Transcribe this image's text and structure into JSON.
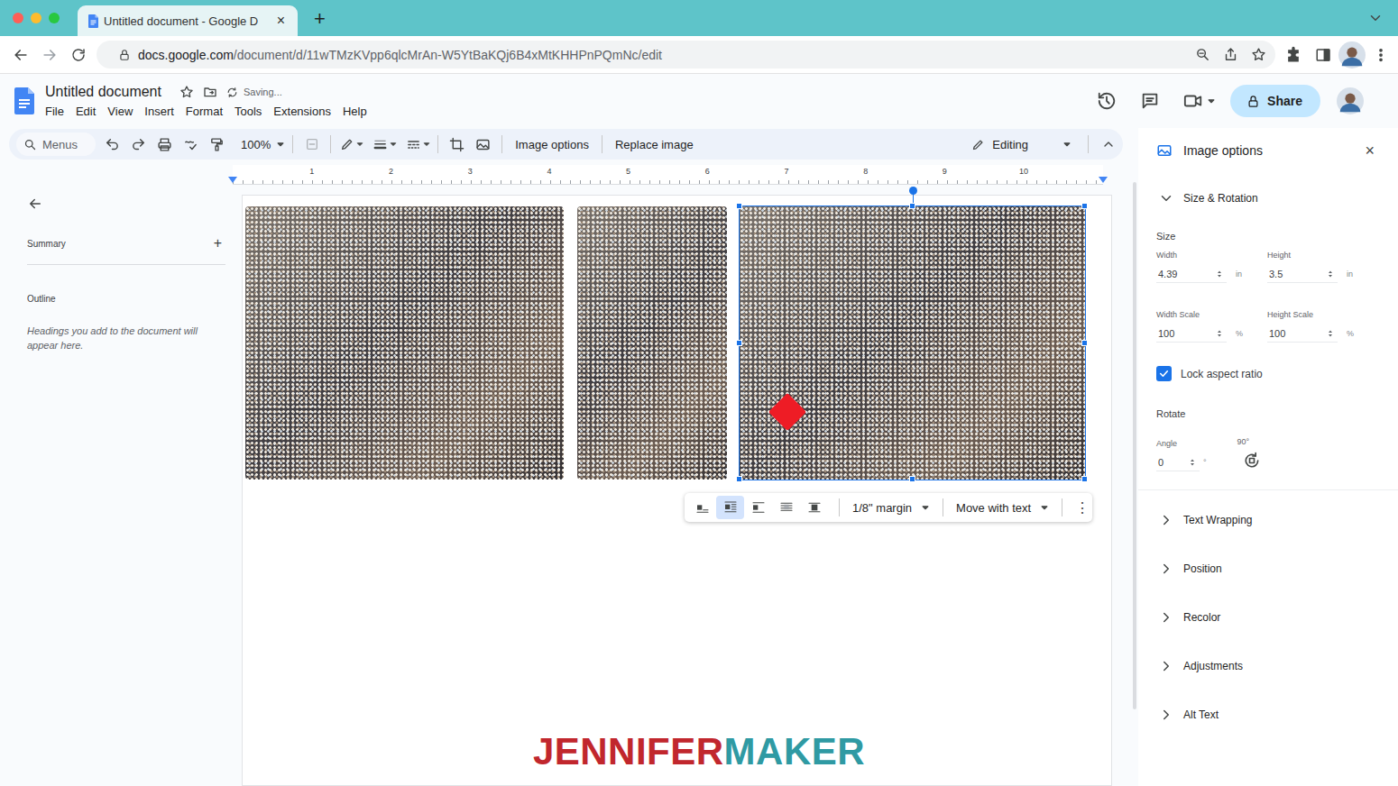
{
  "browser": {
    "tab": {
      "title": "Untitled document - Google D",
      "close": "×",
      "selected": true
    },
    "new_tab": "+",
    "url": {
      "domain": "docs.google.com",
      "path": "/document/d/11wTMzKVpp6qlcMrAn-W5YtBaKQj6B4xMtKHHPnPQmNc/edit"
    }
  },
  "docs": {
    "title": "Untitled document",
    "status": "Saving...",
    "menus": [
      "File",
      "Edit",
      "View",
      "Insert",
      "Format",
      "Tools",
      "Extensions",
      "Help"
    ],
    "share": "Share"
  },
  "toolbar": {
    "search": "Menus",
    "zoom": "100%",
    "image_options": "Image options",
    "replace_image": "Replace image",
    "mode": "Editing"
  },
  "ruler": [
    "1",
    "2",
    "3",
    "4",
    "5",
    "6",
    "7",
    "8",
    "9",
    "10"
  ],
  "outline_panel": {
    "summary": "Summary",
    "add": "+",
    "outline": "Outline",
    "hint": "Headings you add to the document will appear here."
  },
  "images": [
    {
      "selected": false
    },
    {
      "selected": false
    },
    {
      "selected": true
    }
  ],
  "image_toolbar": {
    "wrap_modes": [
      {
        "selected": false
      },
      {
        "selected": true
      },
      {
        "selected": false
      },
      {
        "selected": false
      },
      {
        "selected": false
      }
    ],
    "margin": "1/8\" margin",
    "position": "Move with text",
    "more": "⋮"
  },
  "image_options": {
    "title": "Image options",
    "close": "×",
    "size_rotation": {
      "label": "Size & Rotation",
      "expanded": true,
      "size": "Size",
      "fields": [
        {
          "label": "Width",
          "value": "4.39",
          "unit": "in"
        },
        {
          "label": "Height",
          "value": "3.5",
          "unit": "in"
        },
        {
          "label": "Width Scale",
          "value": "100",
          "unit": "%"
        },
        {
          "label": "Height Scale",
          "value": "100",
          "unit": "%"
        }
      ],
      "lock": {
        "label": "Lock aspect ratio",
        "checked": true
      },
      "rotate": "Rotate",
      "angle": {
        "label": "Angle",
        "value": "0",
        "unit": "°"
      },
      "rotate_90": "90°"
    },
    "sections": [
      {
        "label": "Text Wrapping",
        "expanded": false
      },
      {
        "label": "Position",
        "expanded": false
      },
      {
        "label": "Recolor",
        "expanded": false
      },
      {
        "label": "Adjustments",
        "expanded": false
      },
      {
        "label": "Alt Text",
        "expanded": false
      }
    ]
  },
  "watermark": [
    {
      "text": "JENNIFER",
      "color": "#c1272d"
    },
    {
      "text": "MAKER",
      "color": "#2f9aa3"
    }
  ]
}
